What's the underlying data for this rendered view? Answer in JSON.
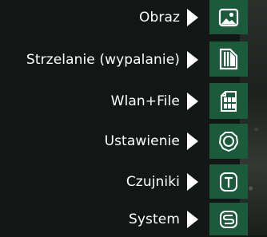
{
  "menu": {
    "items": [
      {
        "label": "Obraz",
        "icon": "image-icon"
      },
      {
        "label": "Strzelanie (wypalanie)",
        "icon": "burn-icon"
      },
      {
        "label": "Wlan+File",
        "icon": "wlan-file-icon"
      },
      {
        "label": "Ustawienie",
        "icon": "settings-gear-icon"
      },
      {
        "label": "Czujniki",
        "icon": "sensors-icon"
      },
      {
        "label": "System",
        "icon": "system-icon"
      }
    ]
  },
  "colors": {
    "tile": "#1b5a3a",
    "background": "#121715",
    "text": "#ffffff",
    "icon": "#ffffff"
  }
}
